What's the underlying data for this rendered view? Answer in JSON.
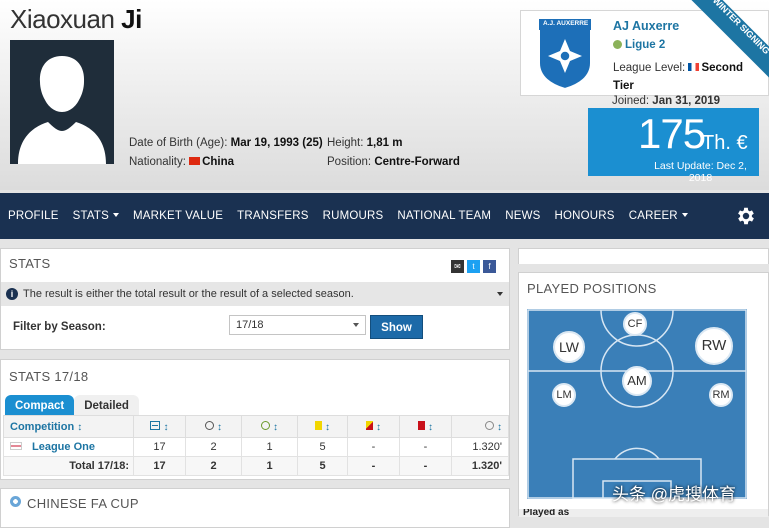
{
  "player": {
    "first_name": "Xiaoxuan",
    "last_name": "Ji",
    "dob_label": "Date of Birth (Age):",
    "dob_value": "Mar 19, 1993 (25)",
    "nationality_label": "Nationality:",
    "nationality_value": "China",
    "height_label": "Height:",
    "height_value": "1,81 m",
    "position_label": "Position:",
    "position_value": "Centre-Forward"
  },
  "club": {
    "crest_text": "A.J. AUXERRE",
    "name": "AJ Auxerre",
    "league": "Ligue 2",
    "level_label": "League Level:",
    "level_value": "Second Tier",
    "joined_label": "Joined:",
    "joined_value": "Jan 31, 2019",
    "ribbon": "WINTER SIGNING"
  },
  "market_value": {
    "amount": "175",
    "unit": "Th. €",
    "last_update": "Last Update: Dec 2, 2018"
  },
  "nav": {
    "items": [
      "PROFILE",
      "STATS",
      "MARKET VALUE",
      "TRANSFERS",
      "RUMOURS",
      "NATIONAL TEAM",
      "NEWS",
      "HONOURS",
      "CAREER"
    ],
    "dropdowns": [
      "STATS",
      "CAREER"
    ]
  },
  "stats_panel": {
    "title": "STATS",
    "info": "The result is either the total result or the result of a selected season.",
    "filter_label": "Filter by Season:",
    "season_value": "17/18",
    "show_button": "Show"
  },
  "season_panel": {
    "title": "STATS 17/18",
    "tabs": [
      "Compact",
      "Detailed"
    ],
    "header_competition": "Competition",
    "rows": [
      {
        "competition": "League One",
        "apps": "17",
        "goals": "2",
        "assists": "1",
        "yellow": "5",
        "yellow_red": "-",
        "red": "-",
        "minutes": "1.320'"
      }
    ],
    "total": {
      "label": "Total 17/18:",
      "apps": "17",
      "goals": "2",
      "assists": "1",
      "yellow": "5",
      "yellow_red": "-",
      "red": "-",
      "minutes": "1.320'"
    }
  },
  "cup_panel": {
    "title": "CHINESE FA CUP"
  },
  "positions_panel": {
    "title": "PLAYED POSITIONS",
    "positions": [
      "CF",
      "LW",
      "RW",
      "AM",
      "LM",
      "RM"
    ],
    "played_as": "Played as"
  },
  "watermark": "头条 @虎搜体育",
  "colors": {
    "nav": "#1a3151",
    "accent": "#1b8fd1",
    "link": "#1d75a3",
    "pitch": "#3a7fb8"
  }
}
